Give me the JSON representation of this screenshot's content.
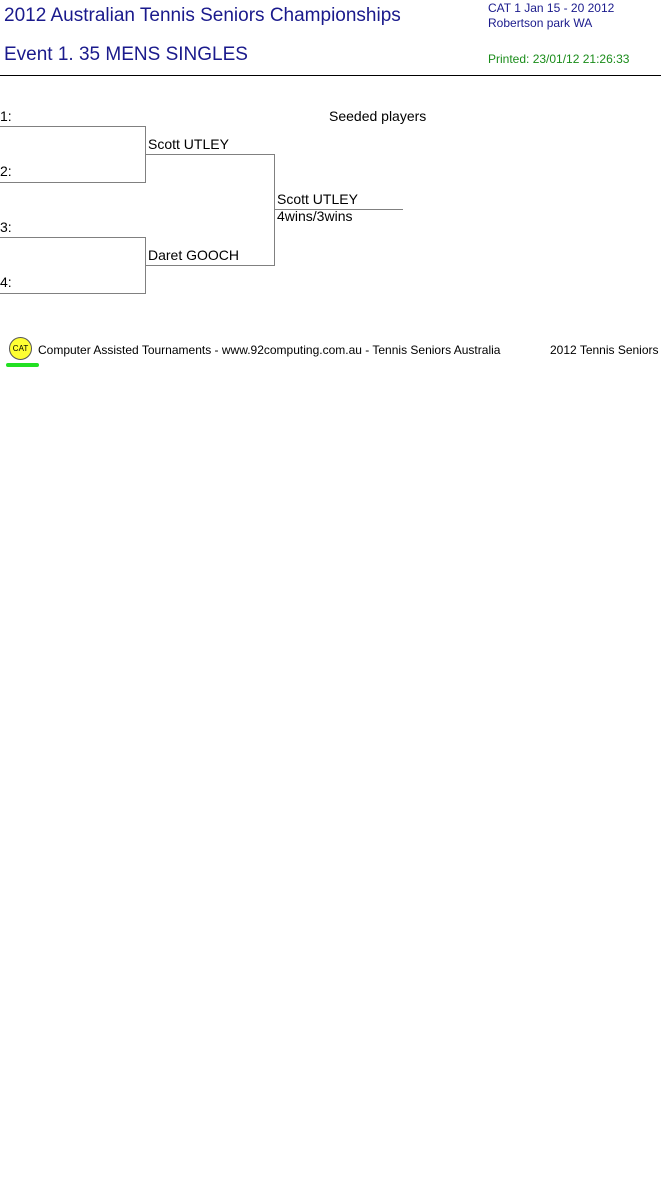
{
  "header": {
    "tournament_title": "2012 Australian Tennis Seniors Championships",
    "event_title": "Event 1. 35 MENS SINGLES",
    "category_dates": "CAT 1   Jan 15 - 20 2012",
    "venue": "Robertson park   WA",
    "printed": "Printed: 23/01/12 21:26:33"
  },
  "draw": {
    "seeded_label": "Seeded players",
    "positions": [
      "1:",
      "2:",
      "3:",
      "4:"
    ],
    "round2": [
      "Scott UTLEY",
      "Daret GOOCH"
    ],
    "final_winner": "Scott UTLEY",
    "final_score": "4wins/3wins"
  },
  "footer": {
    "logo_text": "CAT",
    "credit": "Computer Assisted Tournaments - www.92computing.com.au -  Tennis Seniors Australia",
    "right_text": "2012 Tennis Seniors"
  }
}
